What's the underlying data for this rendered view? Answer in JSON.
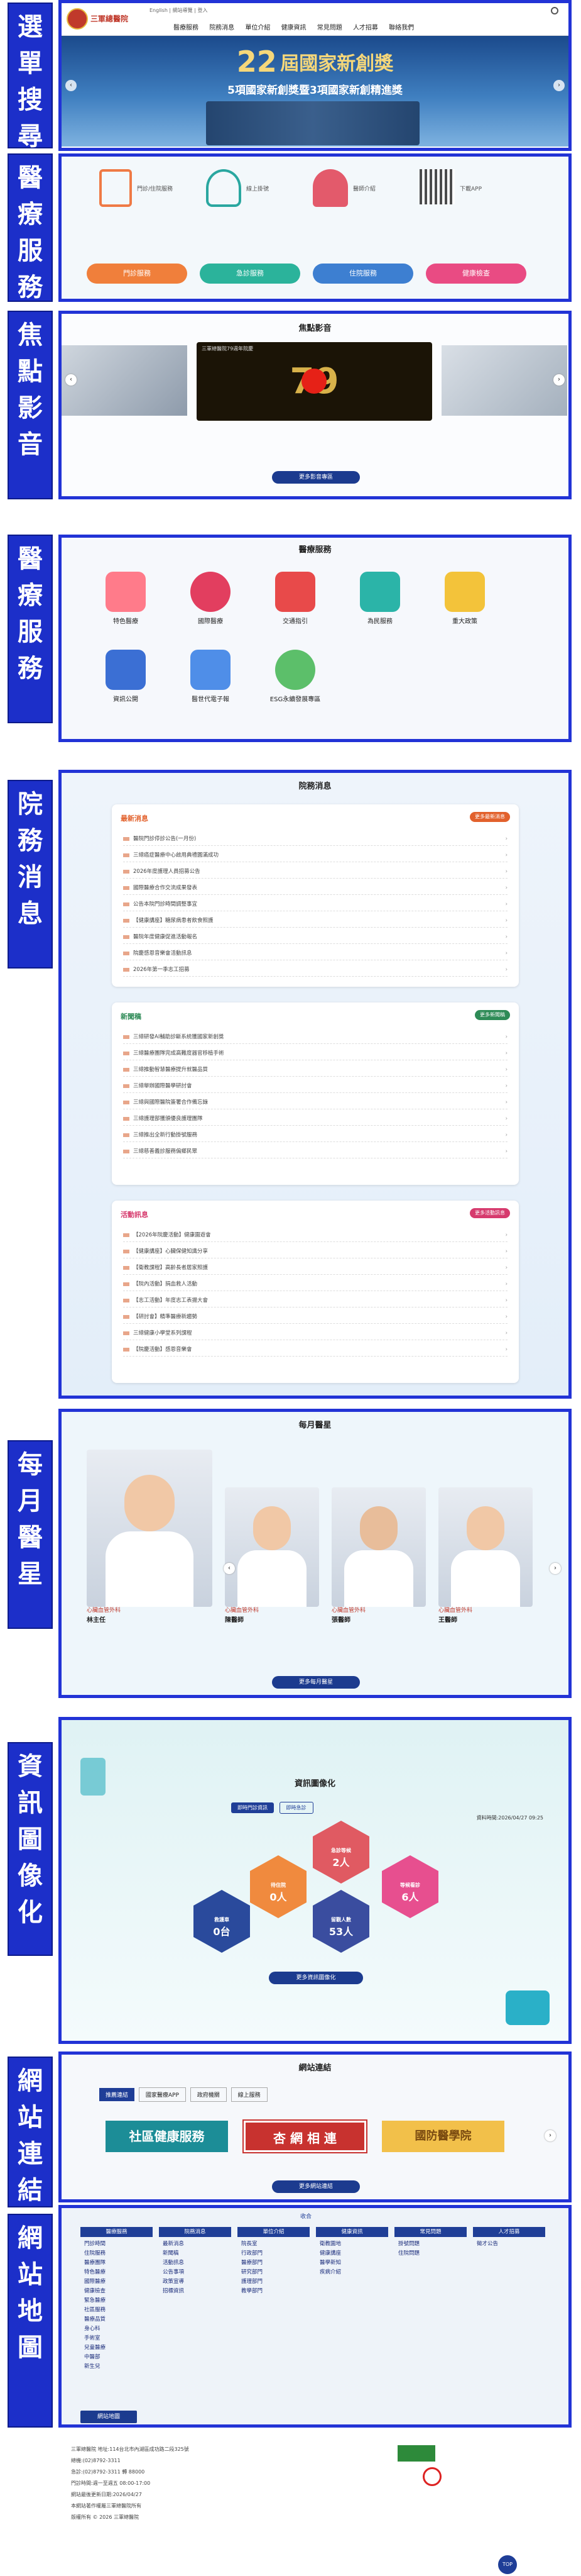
{
  "labels": [
    "選單搜尋",
    "醫療服務",
    "焦點影音",
    "醫療服務",
    "院務消息",
    "每月醫星",
    "資訊圖像化",
    "網站連結",
    "網站地圖"
  ],
  "header": {
    "logo": "三軍總醫院",
    "nav": [
      "醫療服務",
      "院務消息",
      "單位介紹",
      "健康資訊",
      "常見問題",
      "人才招募",
      "聯絡我們"
    ],
    "top_links": [
      "English",
      "網站導覽",
      "登入"
    ]
  },
  "hero": {
    "big": "22",
    "line1": "屆國家新創獎",
    "line2": "5項國家新創獎暨3項國家新創精進獎"
  },
  "med1": {
    "items": [
      "門診/住院服務",
      "線上掛號",
      "醫師介紹",
      "下載APP"
    ],
    "pills": [
      "門診服務",
      "急診服務",
      "住院服務",
      "健康檢查"
    ]
  },
  "focus": {
    "title": "焦點影音",
    "caption": "三軍總醫院79週年院慶",
    "anniv": "79",
    "more": "更多影音專區"
  },
  "med2": {
    "title": "醫療服務",
    "items": [
      "特色醫療",
      "國際醫療",
      "交通指引",
      "為民服務",
      "重大政策",
      "資訊公開",
      "醫世代電子報",
      "ESG永續發展專區"
    ]
  },
  "news": {
    "title": "院務消息",
    "latest": {
      "title": "最新消息",
      "more": "更多最新消息",
      "rows": [
        "醫院門診停診公告(一月份)",
        "三總癌症醫療中心啟用典禮圓滿成功",
        "2026年度護理人員招募公告",
        "國際醫療合作交流成果發表",
        "公告本院門診時間調整事宜",
        "【健康講座】糖尿病患者飲食照護",
        "醫院年度健康促進活動報名",
        "院慶感恩音樂會活動訊息",
        "2026年第一季志工招募"
      ]
    },
    "press": {
      "title": "新聞稿",
      "more": "更多新聞稿",
      "rows": [
        "三總研發AI輔助診斷系統獲國家新創獎",
        "三總醫療團隊完成高難度器官移植手術",
        "三總推動智慧醫療提升就醫品質",
        "三總舉辦國際醫學研討會",
        "三總與國際醫院簽署合作備忘錄",
        "三總護理部獲頒優良護理團隊",
        "三總推出全新行動掛號服務",
        "三總慈善義診服務偏鄉民眾"
      ]
    },
    "events": {
      "title": "活動訊息",
      "more": "更多活動訊息",
      "rows": [
        "【2026年院慶活動】健康園遊會",
        "【健康講座】心臟保健知識分享",
        "【衛教課程】高齡長者居家照護",
        "【院內活動】捐血救人活動",
        "【志工活動】年度志工表揚大會",
        "【研討會】精準醫療新趨勢",
        "三總健康小學堂系列課程",
        "【院慶活動】感恩音樂會"
      ]
    }
  },
  "doctors": {
    "title": "每月醫星",
    "more": "更多每月醫星",
    "list": [
      {
        "dept": "心臟血管外科",
        "name": "林主任"
      },
      {
        "dept": "心臟血管外科",
        "name": "陳醫師"
      },
      {
        "dept": "心臟血管外科",
        "name": "張醫師"
      },
      {
        "dept": "心臟血管外科",
        "name": "王醫師"
      }
    ]
  },
  "info": {
    "title": "資訊圖像化",
    "tabs": [
      "即時門診資訊",
      "即時急診"
    ],
    "date": "資料時間:2026/04/27 09:25",
    "hex": [
      {
        "t": "急診等候",
        "v": "2人"
      },
      {
        "t": "待住院",
        "v": "0人"
      },
      {
        "t": "等候看診",
        "v": "6人"
      },
      {
        "t": "救護車",
        "v": "0台"
      },
      {
        "t": "留觀人數",
        "v": "53人"
      }
    ],
    "more": "更多資訊圖像化"
  },
  "links": {
    "title": "網站連結",
    "tabs": [
      "推薦連結",
      "國家醫療APP",
      "政府機關",
      "線上服務"
    ],
    "banners": [
      "社區健康服務",
      "杏 網 相 連",
      "國防醫學院"
    ],
    "more": "更多網站連結"
  },
  "sitemap": {
    "toggle": "收合",
    "cols": [
      {
        "h": "醫療服務",
        "items": [
          "門診時間",
          "住院服務",
          "醫療團隊",
          "特色醫療",
          "國際醫療",
          "健康檢查",
          "緊急醫療",
          "社區服務",
          "醫療品質",
          "身心科",
          "手術室",
          "兒童醫療",
          "中醫部",
          "新生兒"
        ]
      },
      {
        "h": "院務消息",
        "items": [
          "最新消息",
          "新聞稿",
          "活動訊息",
          "公告事項",
          "政策宣導",
          "招標資訊"
        ]
      },
      {
        "h": "單位介紹",
        "items": [
          "院長室",
          "行政部門",
          "醫療部門",
          "研究部門",
          "護理部門",
          "教學部門"
        ]
      },
      {
        "h": "健康資訊",
        "items": [
          "衛教園地",
          "健康講座",
          "醫學新知",
          "疾病介紹"
        ]
      },
      {
        "h": "常見問題",
        "items": [
          "掛號問題",
          "住院問題"
        ]
      },
      {
        "h": "人才招募",
        "items": [
          "徵才公告"
        ]
      }
    ],
    "more": "網站地圖"
  },
  "footer": {
    "lines": [
      "三軍總醫院 地址:114台北市內湖區成功路二段325號",
      "總機:(02)8792-3311",
      "急診:(02)8792-3311 轉 88000",
      "門診時間:週一至週五 08:00-17:00",
      "網站最後更新日期:2026/04/27",
      "本網站著作權屬三軍總醫院所有",
      "版權所有 © 2026 三軍總醫院"
    ],
    "top": "TOP"
  }
}
